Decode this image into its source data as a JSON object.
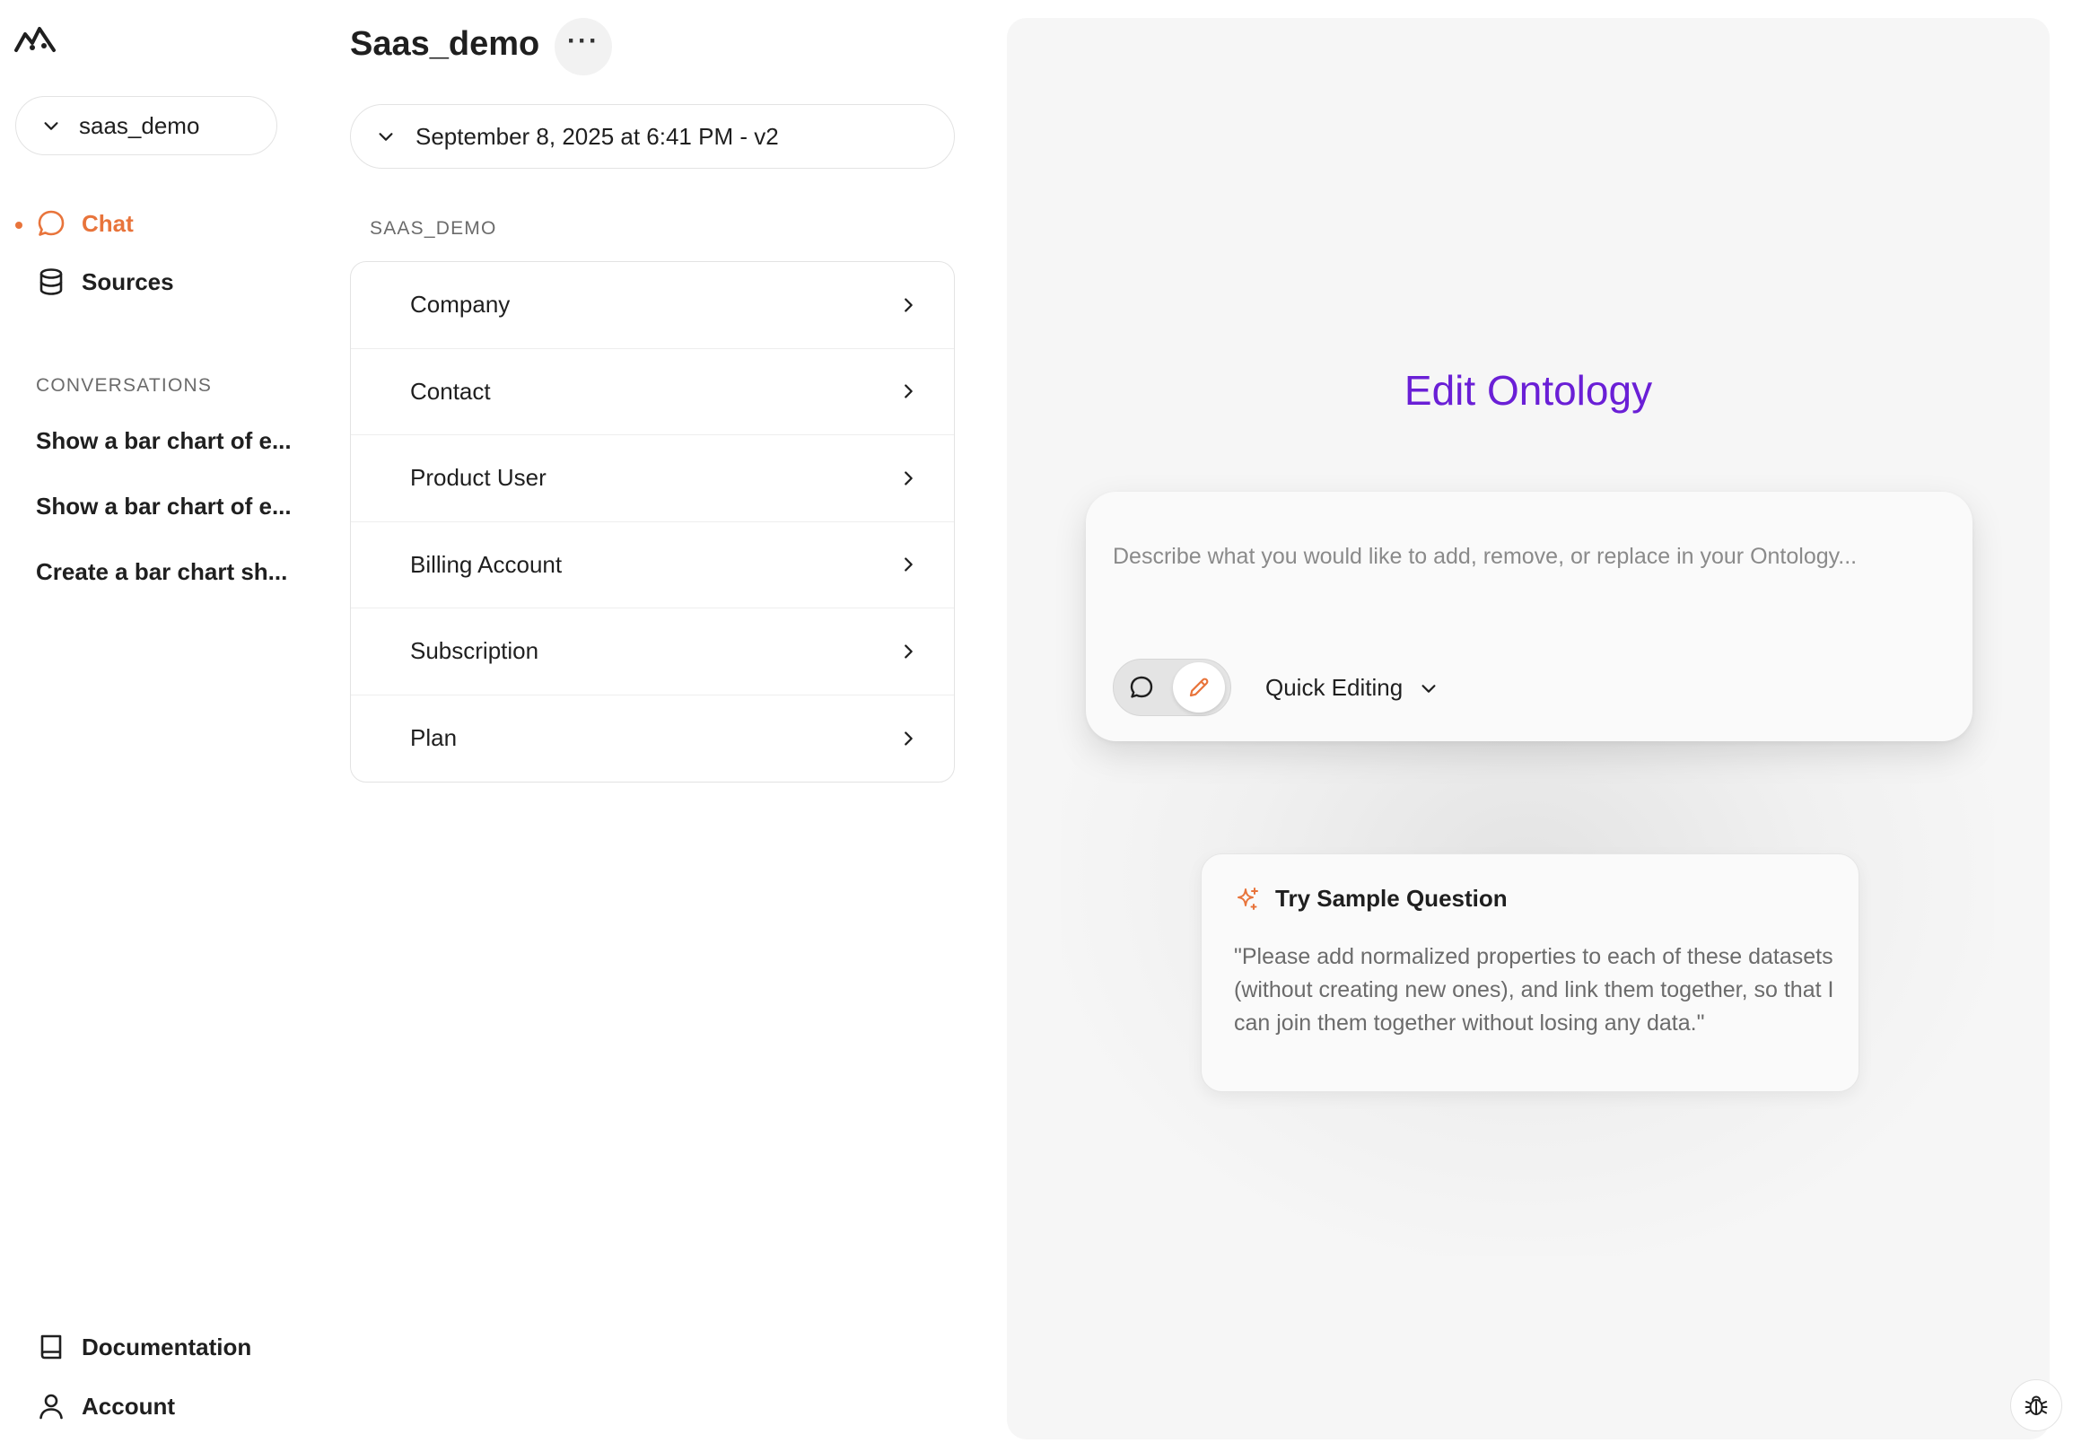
{
  "sidebar": {
    "workspace_select": {
      "value": "saas_demo"
    },
    "nav": {
      "chat": "Chat",
      "sources": "Sources",
      "documentation": "Documentation",
      "account": "Account"
    },
    "conversations_label": "CONVERSATIONS",
    "conversations": [
      "Show a bar chart of e...",
      "Show a bar chart of e...",
      "Create a bar chart sh..."
    ]
  },
  "project": {
    "title": "Saas_demo",
    "more_label": "···",
    "version_select": {
      "value": "September 8, 2025 at 6:41 PM - v2"
    },
    "schema_label": "SAAS_DEMO",
    "entities": [
      "Company",
      "Contact",
      "Product User",
      "Billing Account",
      "Subscription",
      "Plan"
    ]
  },
  "editor": {
    "title": "Edit Ontology",
    "prompt_placeholder": "Describe what you would like to add, remove, or replace in your Ontology...",
    "mode_select": {
      "value": "Quick Editing"
    },
    "sample": {
      "heading": "Try Sample Question",
      "text": "\"Please add normalized properties to each of these datasets (without creating new ones), and link them together, so that I can join them together without losing any data.\""
    }
  },
  "colors": {
    "accent_orange": "#e8743b",
    "title_purple": "#6a1fd6",
    "panel_bg": "#f6f6f6"
  },
  "icons": [
    "logo-icon",
    "chevron-down-icon",
    "chat-bubble-icon",
    "database-icon",
    "more-icon",
    "chevron-right-icon",
    "pencil-icon",
    "sparkle-icon",
    "book-icon",
    "user-icon",
    "bug-icon"
  ]
}
